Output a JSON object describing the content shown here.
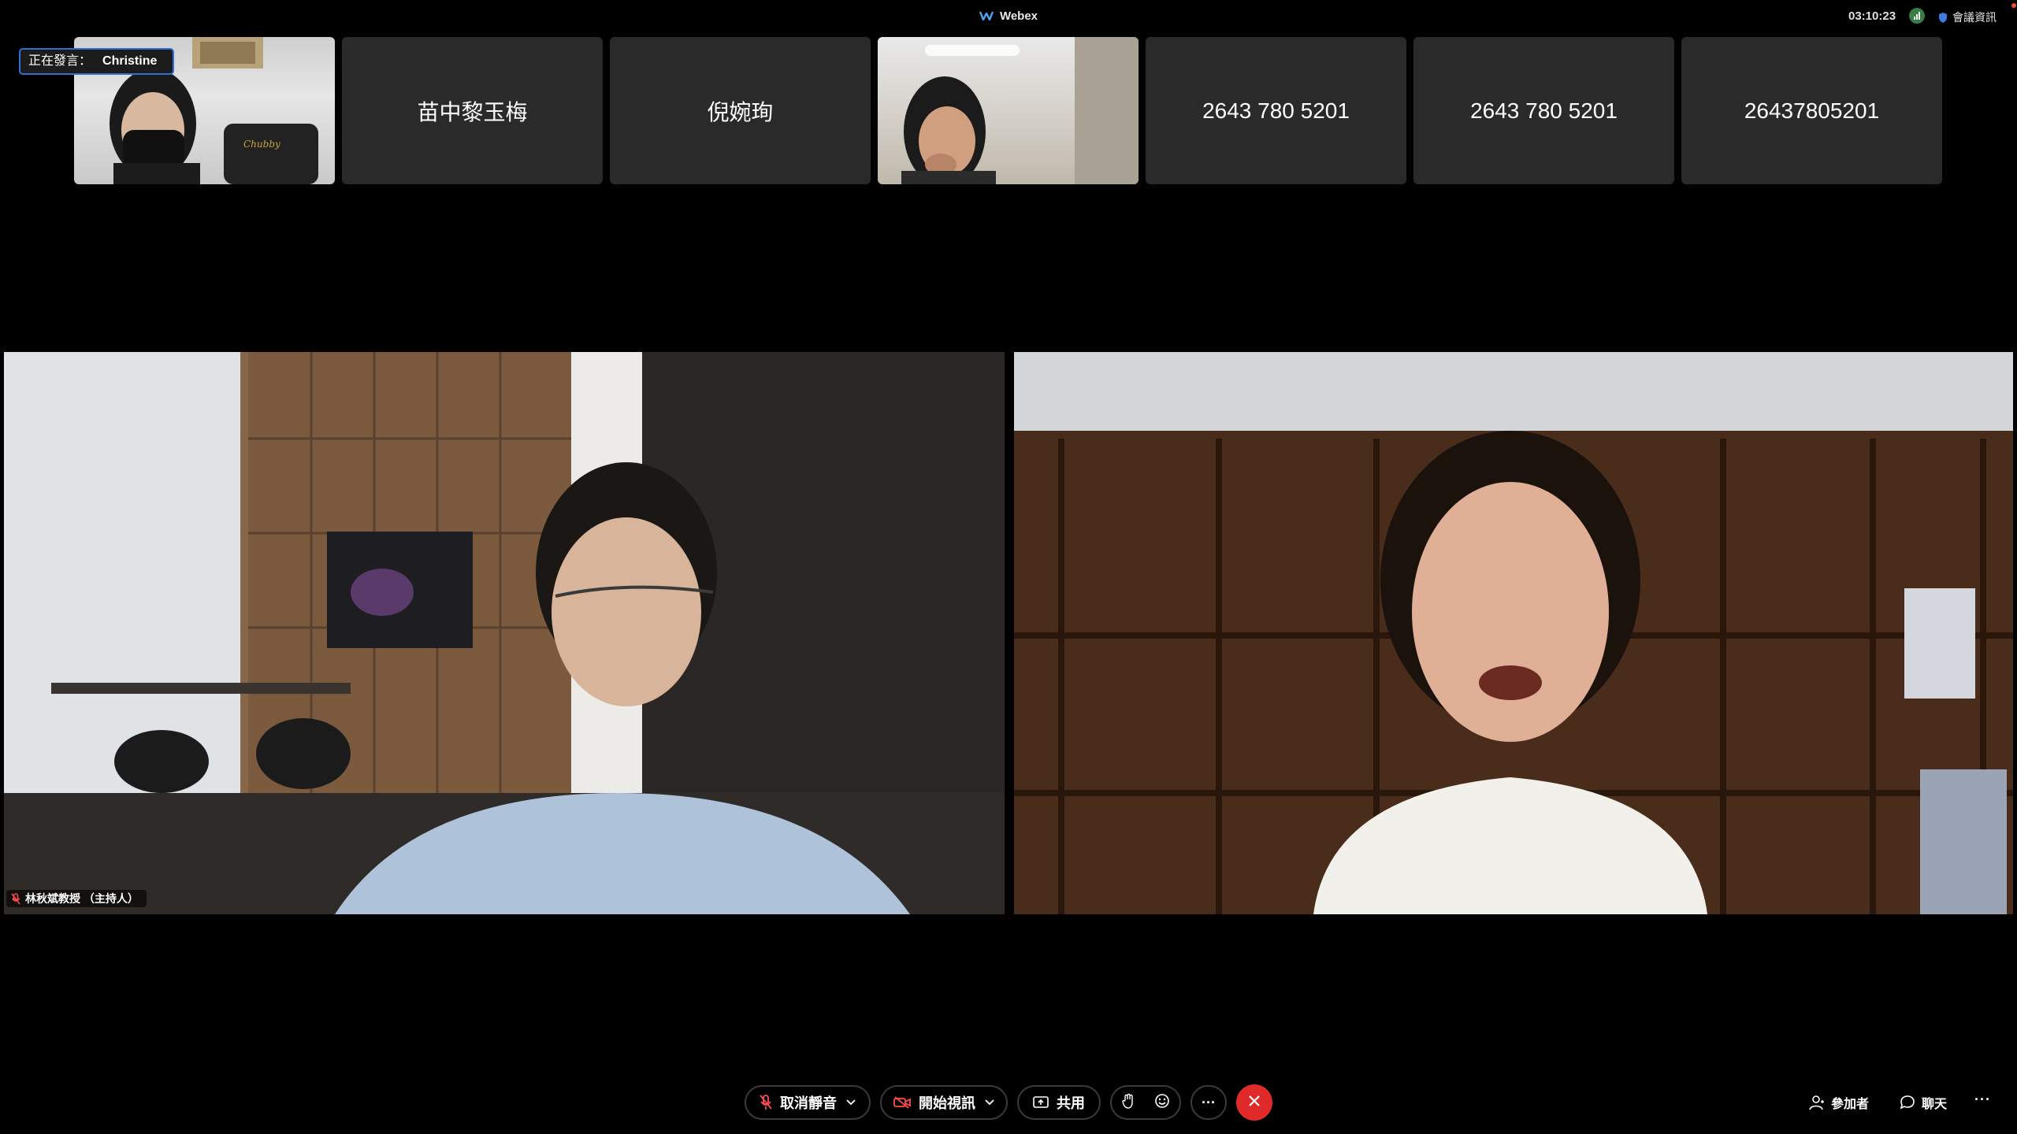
{
  "titlebar": {
    "app_title": "Webex",
    "clock": "03:10:23",
    "meeting_info_label": "會議資訊"
  },
  "speaking": {
    "label": "正在發言：",
    "name": "Christine"
  },
  "thumbnails": [
    {
      "type": "video",
      "name": ""
    },
    {
      "type": "name",
      "name": "苗中黎玉梅"
    },
    {
      "type": "name",
      "name": "倪婉珣"
    },
    {
      "type": "video",
      "name": ""
    },
    {
      "type": "name",
      "name": "2643 780 5201"
    },
    {
      "type": "name",
      "name": "2643 780 5201"
    },
    {
      "type": "name",
      "name": "26437805201"
    }
  ],
  "main_panes": {
    "left_name": "林秋斌教授 （主持人）"
  },
  "toolbar": {
    "mute_label": "取消靜音",
    "video_label": "開始視訊",
    "share_label": "共用",
    "more_label": "···",
    "participants_label": "參加者",
    "chat_label": "聊天",
    "overflow_label": "···"
  },
  "colors": {
    "leave": "#e02a2a",
    "speaking_border": "#2f6fd6",
    "tile_bg": "#2a2a2a"
  }
}
